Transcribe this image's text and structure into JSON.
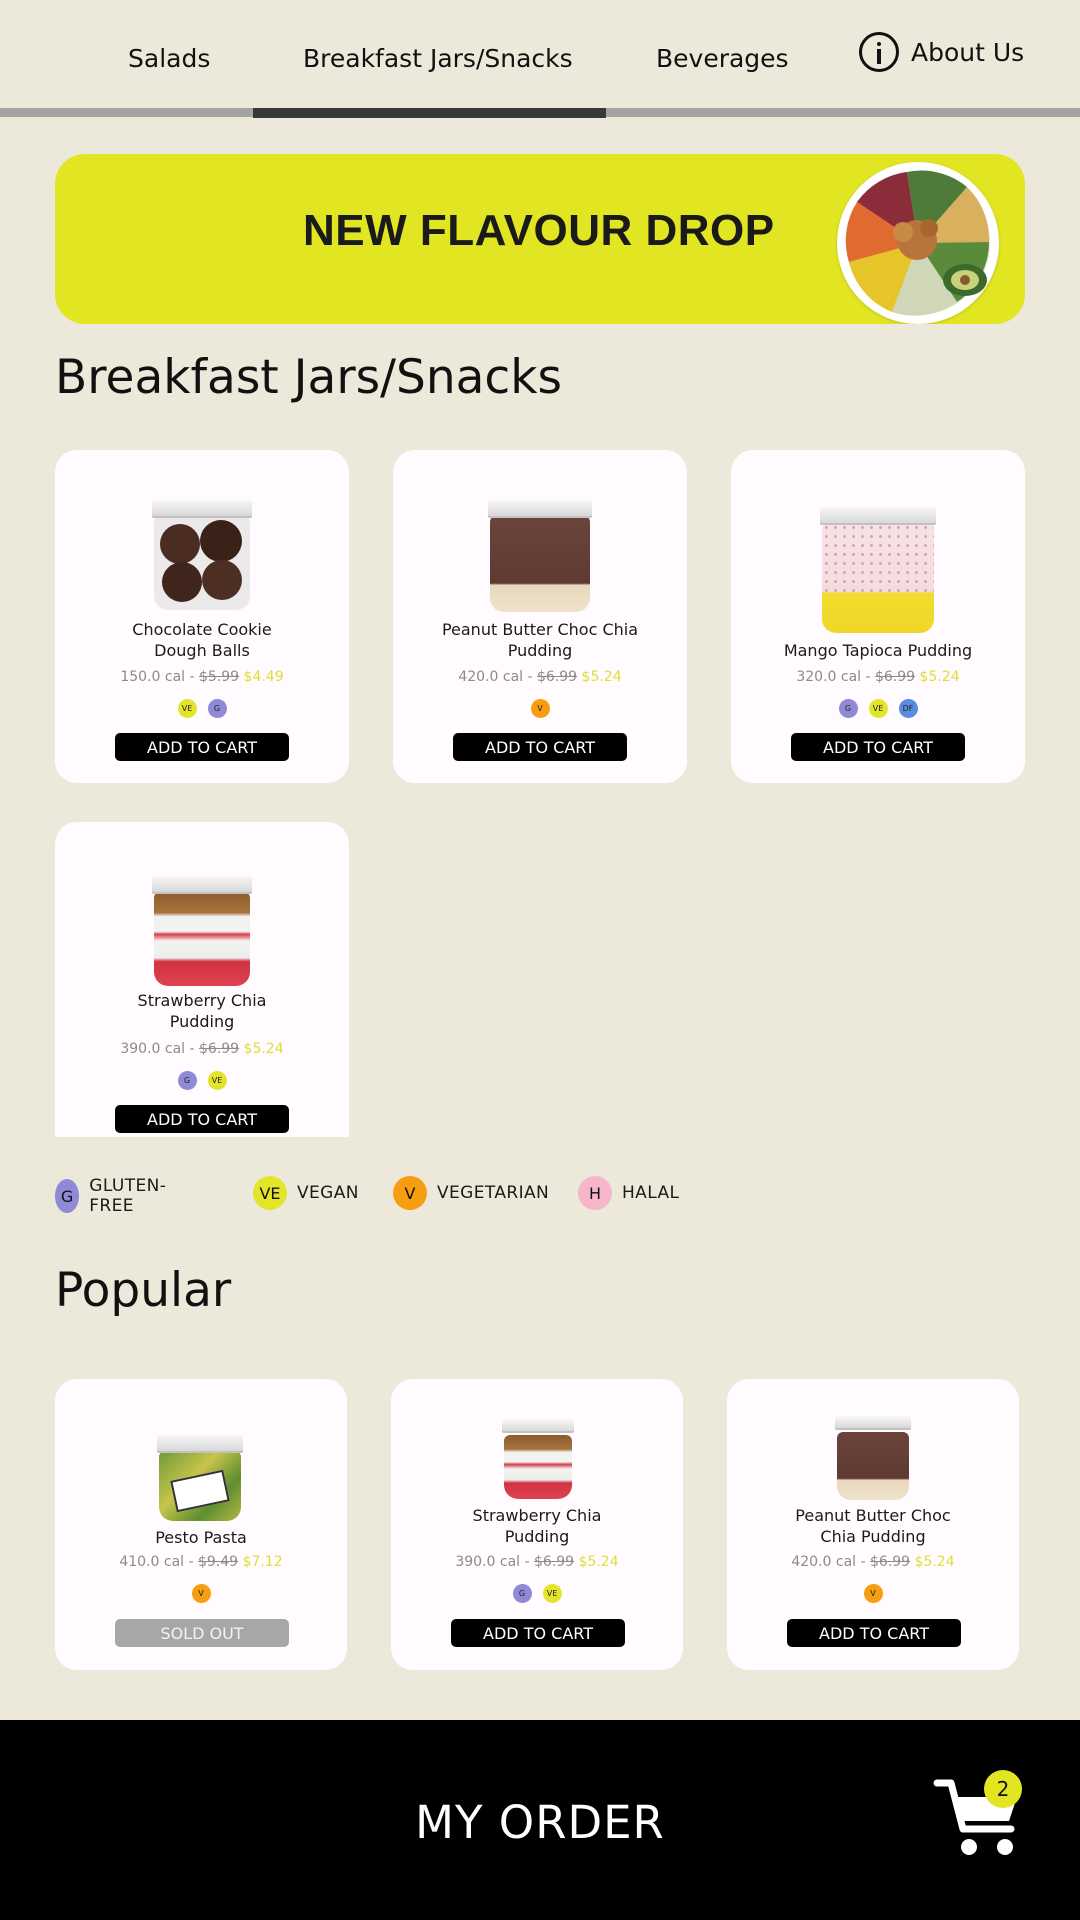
{
  "nav": {
    "tabs": [
      {
        "label": "Salads"
      },
      {
        "label": "Breakfast Jars/Snacks"
      },
      {
        "label": "Beverages"
      }
    ],
    "about_label": "About Us"
  },
  "banner": {
    "title": "NEW FLAVOUR DROP"
  },
  "section": {
    "title": "Breakfast Jars/Snacks"
  },
  "products": [
    {
      "name": "Chocolate Cookie\nDough Balls",
      "cal": "150.0 cal - ",
      "old_price": "$5.99",
      "new_price": "$4.49",
      "badges": [
        "VE",
        "G"
      ],
      "button": "ADD TO CART"
    },
    {
      "name": "Peanut Butter Choc Chia\nPudding",
      "cal": "420.0 cal - ",
      "old_price": "$6.99",
      "new_price": "$5.24",
      "badges": [
        "V"
      ],
      "button": "ADD TO CART"
    },
    {
      "name": "Mango Tapioca Pudding",
      "cal": "320.0 cal - ",
      "old_price": "$6.99",
      "new_price": "$5.24",
      "badges": [
        "G",
        "VE",
        "DF"
      ],
      "button": "ADD TO CART"
    },
    {
      "name": "Strawberry Chia\nPudding",
      "cal": "390.0 cal - ",
      "old_price": "$6.99",
      "new_price": "$5.24",
      "badges": [
        "G",
        "VE"
      ],
      "button": "ADD TO CART"
    }
  ],
  "legend": [
    {
      "code": "G",
      "label": "GLUTEN-FREE",
      "color": "#8f8ad8"
    },
    {
      "code": "VE",
      "label": "VEGAN",
      "color": "#e3e52a"
    },
    {
      "code": "V",
      "label": "VEGETARIAN",
      "color": "#f79d10"
    },
    {
      "code": "H",
      "label": "HALAL",
      "color": "#f6b5c8"
    }
  ],
  "popular": {
    "title": "Popular",
    "items": [
      {
        "name": "Pesto Pasta",
        "cal": "410.0 cal - ",
        "old_price": "$9.49",
        "new_price": "$7.12",
        "badges": [
          "V"
        ],
        "button": "SOLD OUT"
      },
      {
        "name": "Strawberry Chia\nPudding",
        "cal": "390.0 cal - ",
        "old_price": "$6.99",
        "new_price": "$5.24",
        "badges": [
          "G",
          "VE"
        ],
        "button": "ADD TO CART"
      },
      {
        "name": "Peanut Butter Choc\nChia Pudding",
        "cal": "420.0 cal - ",
        "old_price": "$6.99",
        "new_price": "$5.24",
        "badges": [
          "V"
        ],
        "button": "ADD TO CART"
      }
    ]
  },
  "order": {
    "label": "MY ORDER",
    "cart_count": "2"
  },
  "icons": {
    "info": "info-icon",
    "cart": "shopping-cart-icon"
  },
  "colors": {
    "background": "#ece9db",
    "accent": "#e1e522",
    "price_new": "#dede34"
  }
}
